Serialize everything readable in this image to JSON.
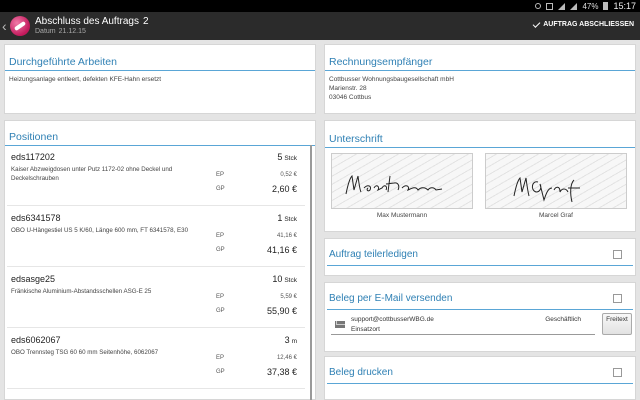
{
  "statusbar": {
    "battery": "47%",
    "time": "15:17"
  },
  "actionbar": {
    "title": "Abschluss des Auftrags",
    "title_number": "2",
    "date_label": "Datum",
    "date_value": "21.12.15",
    "finish_button": "AUFTRAG ABSCHLIESSEN"
  },
  "work": {
    "title": "Durchgeführte Arbeiten",
    "text": "Heizungsanlage entleert, defekten KFE-Hahn ersetzt"
  },
  "recipient": {
    "title": "Rechnungsempfänger",
    "company": "Cottbusser Wohnungsbaugesellschaft mbH",
    "street": "Marienstr. 28",
    "city": "03046 Cottbus"
  },
  "positions": {
    "title": "Positionen",
    "ep_label": "EP",
    "gp_label": "GP",
    "items": [
      {
        "code": "eds117202",
        "qty": "5",
        "unit": "Stck",
        "desc": "Kaiser Abzweigdosen unter Putz 1172-02 ohne Deckel und Deckelschrauben",
        "ep": "0,52 €",
        "gp": "2,60 €"
      },
      {
        "code": "eds6341578",
        "qty": "1",
        "unit": "Stck",
        "desc": "OBO U-Hängestiel US 5 K/60, Länge 600 mm, FT 6341578, E30",
        "ep": "41,16 €",
        "gp": "41,16 €"
      },
      {
        "code": "edsasge25",
        "qty": "10",
        "unit": "Stck",
        "desc": "Fränkische Aluminium-Abstandsschellen ASG-E 25",
        "ep": "5,59 €",
        "gp": "55,90 €"
      },
      {
        "code": "eds6062067",
        "qty": "3",
        "unit": "m",
        "desc": "OBO Trennsteg TSG 60 60 mm Seitenhöhe, 6062067",
        "ep": "12,46 €",
        "gp": "37,38 €"
      }
    ]
  },
  "signature": {
    "title": "Unterschrift",
    "signers": [
      "Max Mustermann",
      "Marcel Graf"
    ]
  },
  "partial": {
    "title": "Auftrag teilerledigen"
  },
  "email": {
    "title": "Beleg per E-Mail versenden",
    "address": "support@cottbusserWBG.de",
    "kind": "Geschäftlich",
    "type": "Einsatzort",
    "free_button": "Freitext"
  },
  "print": {
    "title": "Beleg drucken"
  }
}
